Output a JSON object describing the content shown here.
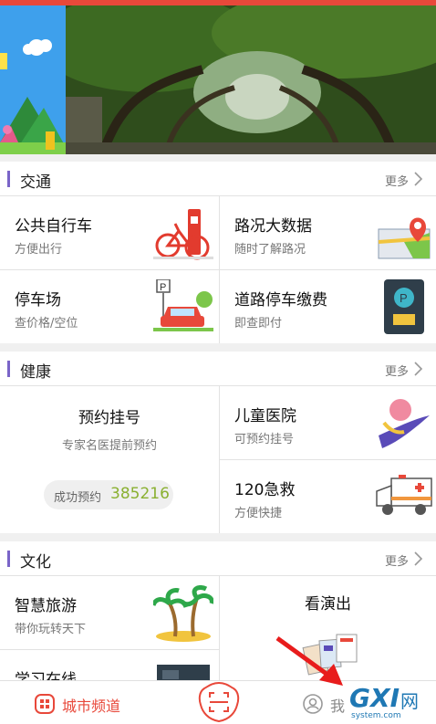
{
  "sections": {
    "traffic": {
      "title": "交通",
      "more": "更多",
      "items": [
        {
          "title": "公共自行车",
          "subtitle": "方便出行",
          "icon": "bicycle-icon"
        },
        {
          "title": "路况大数据",
          "subtitle": "随时了解路况",
          "icon": "map-pin-icon"
        },
        {
          "title": "停车场",
          "subtitle": "查价格/空位",
          "icon": "parking-car-icon"
        },
        {
          "title": "道路停车缴费",
          "subtitle": "即查即付",
          "icon": "parking-meter-icon"
        }
      ]
    },
    "health": {
      "title": "健康",
      "more": "更多",
      "appointment": {
        "title": "预约挂号",
        "subtitle": "专家名医提前预约",
        "success_label": "成功预约",
        "success_count": "385216"
      },
      "items": [
        {
          "title": "儿童医院",
          "subtitle": "可预约挂号",
          "icon": "child-hospital-icon"
        },
        {
          "title": "120急救",
          "subtitle": "方便快捷",
          "icon": "ambulance-icon"
        }
      ]
    },
    "culture": {
      "title": "文化",
      "more": "更多",
      "items": [
        {
          "title": "智慧旅游",
          "subtitle": "带你玩转天下",
          "icon": "palm-island-icon"
        },
        {
          "title": "看演出",
          "subtitle": "",
          "icon": "tickets-icon"
        },
        {
          "title": "学习在线",
          "subtitle": "",
          "icon": "study-icon"
        }
      ]
    }
  },
  "tabbar": {
    "city_label": "城市频道",
    "me_label": "我"
  },
  "watermark": {
    "main": "GXI",
    "cn": "网",
    "sub": "system.com"
  },
  "colors": {
    "accent": "#e8483a",
    "section_bar": "#7a64c8",
    "count_green": "#8ab031"
  }
}
